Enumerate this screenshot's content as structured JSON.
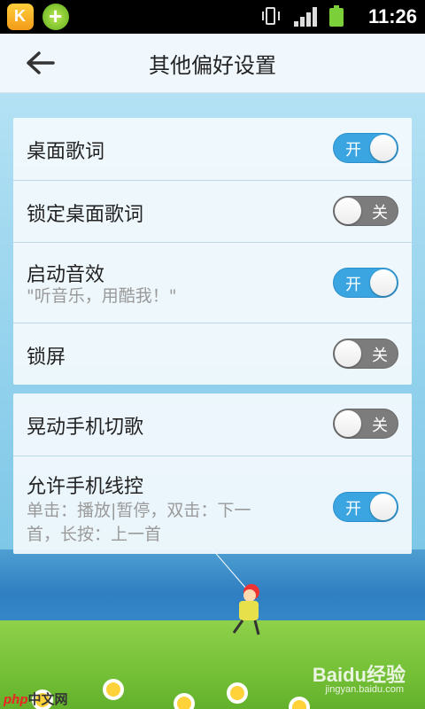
{
  "status_bar": {
    "time": "11:26",
    "icons": [
      "app-k-icon",
      "app-plus-icon",
      "vibrate-icon",
      "signal-icon",
      "battery-icon"
    ]
  },
  "header": {
    "back_icon": "back-arrow-icon",
    "title": "其他偏好设置"
  },
  "groups": [
    {
      "items": [
        {
          "label": "桌面歌词",
          "subtitle": "",
          "state": "开",
          "on": true
        },
        {
          "label": "锁定桌面歌词",
          "subtitle": "",
          "state": "关",
          "on": false
        },
        {
          "label": "启动音效",
          "subtitle": "\"听音乐，用酷我！\"",
          "state": "开",
          "on": true
        },
        {
          "label": "锁屏",
          "subtitle": "",
          "state": "关",
          "on": false
        }
      ]
    },
    {
      "items": [
        {
          "label": "晃动手机切歌",
          "subtitle": "",
          "state": "关",
          "on": false
        },
        {
          "label": "允许手机线控",
          "subtitle_lines": [
            "单击：播放|暂停，双击：下一",
            "首，长按：上一首"
          ],
          "state": "开",
          "on": true
        }
      ]
    }
  ],
  "watermarks": {
    "baidu": "Baidu经验",
    "baidu_sub": "jingyan.baidu.com",
    "php_a": "php",
    "php_b": "中文网"
  },
  "colors": {
    "toggle_on": "#3aa5e0",
    "toggle_off": "#7c7c7c",
    "status_bar": "#000000"
  }
}
